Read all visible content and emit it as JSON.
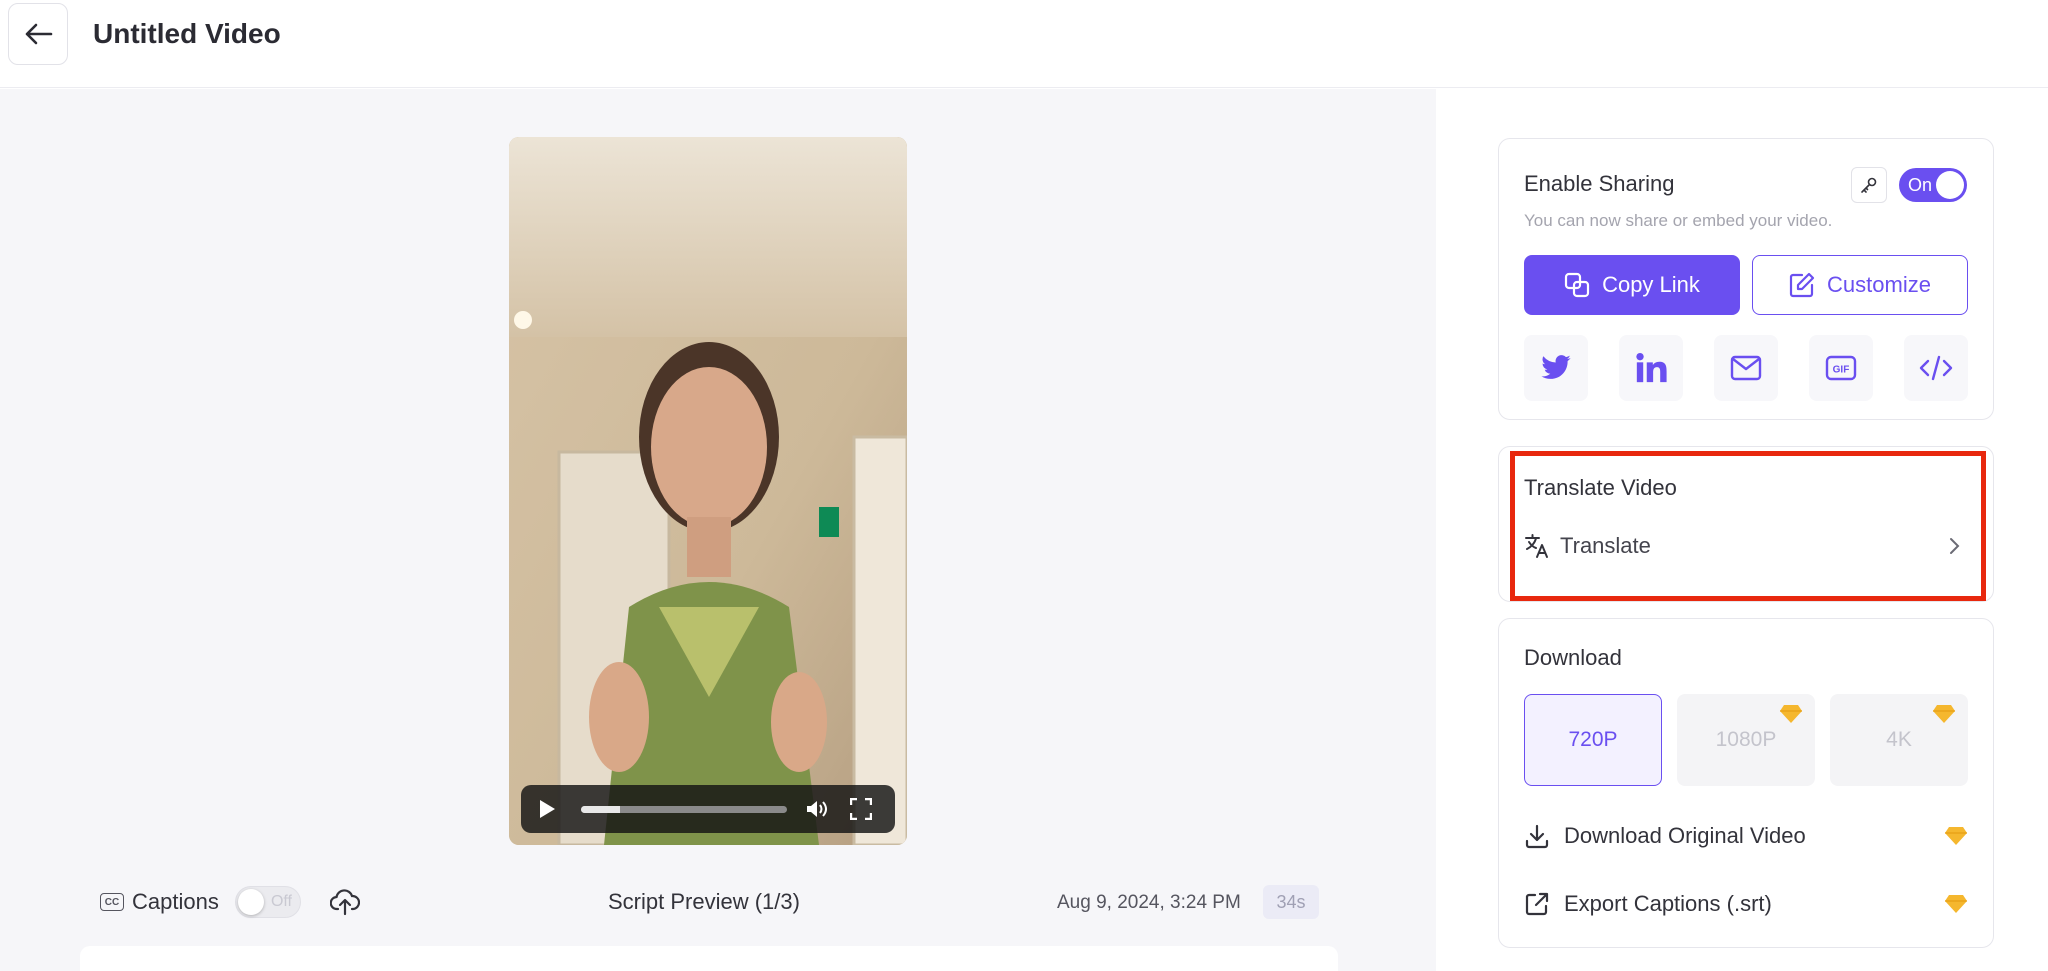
{
  "header": {
    "title": "Untitled Video"
  },
  "player": {
    "progress": 0.19
  },
  "footer": {
    "captions_label": "Captions",
    "captions_toggle": "Off",
    "script_preview": "Script Preview (1/3)",
    "date": "Aug 9, 2024, 3:24 PM",
    "duration": "34s"
  },
  "sharing": {
    "title": "Enable Sharing",
    "toggle_label": "On",
    "subtitle": "You can now share or embed your video.",
    "copy_link_label": "Copy Link",
    "customize_label": "Customize",
    "icons": [
      "twitter-icon",
      "linkedin-icon",
      "mail-icon",
      "gif-icon",
      "embed-code-icon"
    ]
  },
  "translate": {
    "title": "Translate Video",
    "action_label": "Translate"
  },
  "download": {
    "title": "Download",
    "resolutions": [
      "720P",
      "1080P",
      "4K"
    ],
    "original_label": "Download Original Video",
    "captions_label": "Export Captions (.srt)"
  },
  "colors": {
    "accent": "#6a4ff0",
    "highlight": "#e8280e",
    "premium": "#f5b72e"
  }
}
